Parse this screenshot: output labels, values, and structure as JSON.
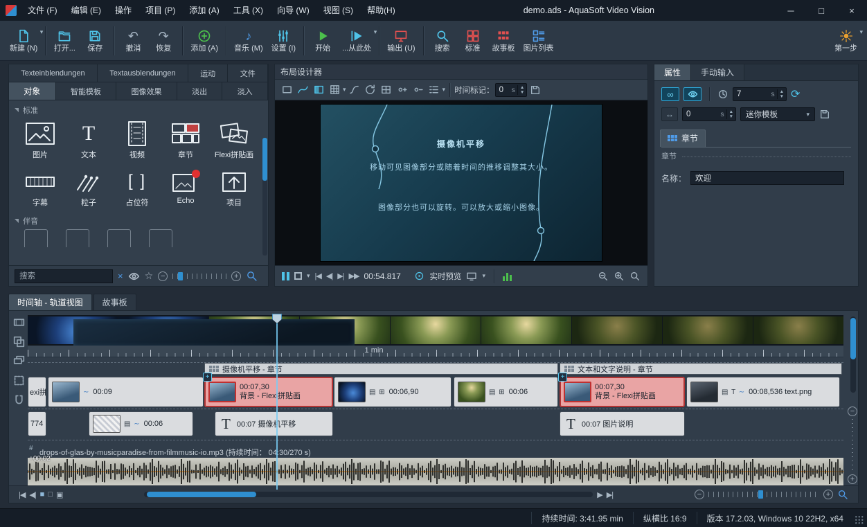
{
  "icons": {
    "chevron_down": "▾",
    "close": "×",
    "minimize": "─",
    "maximize": "□",
    "undo": "↶",
    "redo": "↷",
    "note": "♪",
    "infinity": "∞",
    "arrow_lr": "↔",
    "refresh": "⟳",
    "star": "☆",
    "minus": "−",
    "plus": "+",
    "skip_start": "|◀",
    "step_back": "◀|",
    "step_fwd": "▶|",
    "ffwd": "▶▶",
    "play_one": "▶",
    "play_end": "▶|",
    "stop_sq": "■",
    "frame_sq": "□",
    "split_sq": "▣",
    "film": "▤",
    "grid": "⊞",
    "wave": "∼",
    "t": "T",
    "brackets": "[ ]",
    "hash": "#"
  },
  "window": {
    "title": "demo.ads - AquaSoft Video Vision"
  },
  "menu": {
    "items": [
      "文件 (F)",
      "编辑 (E)",
      "操作",
      "项目 (P)",
      "添加 (A)",
      "工具 (X)",
      "向导 (W)",
      "视图 (S)",
      "帮助(H)"
    ]
  },
  "toolbar": {
    "buttons": [
      {
        "label": "新建 (N)"
      },
      {
        "label": "打开..."
      },
      {
        "label": "保存"
      },
      {
        "label": "撤消"
      },
      {
        "label": "恢复"
      },
      {
        "label": "添加 (A)"
      },
      {
        "label": "音乐 (M)"
      },
      {
        "label": "设置 (I)"
      },
      {
        "label": "开始"
      },
      {
        "label": "...从此处"
      },
      {
        "label": "输出 (U)"
      },
      {
        "label": "搜索"
      },
      {
        "label": "标准"
      },
      {
        "label": "故事板"
      },
      {
        "label": "图片列表"
      }
    ],
    "first_step": "第一步"
  },
  "left_panel": {
    "tabs_top": [
      "Texteinblendungen",
      "Textausblendungen",
      "运动",
      "文件"
    ],
    "tabs_main": [
      "对象",
      "智能模板",
      "图像效果",
      "淡出",
      "淡入"
    ],
    "section_standard": "标准",
    "section_audio": "伴音",
    "items": [
      {
        "label": "图片"
      },
      {
        "label": "文本"
      },
      {
        "label": "视频"
      },
      {
        "label": "章节"
      },
      {
        "label": "Flexi拼贴画"
      },
      {
        "label": "字幕"
      },
      {
        "label": "粒子"
      },
      {
        "label": "占位符"
      },
      {
        "label": "Echo"
      },
      {
        "label": "项目"
      }
    ],
    "search_placeholder": "搜索"
  },
  "designer": {
    "title": "布局设计器",
    "time_marker_label": "时间标记：",
    "time_marker_value": "0",
    "time_unit": "s",
    "slide": {
      "heading": "摄像机平移",
      "body1": "移动可见图像部分或随着时间的推移调整其大小。",
      "body2": "图像部分也可以旋转。可以放大或缩小图像。"
    },
    "transport": {
      "time": "00:54.817",
      "live_preview": "实时预览"
    }
  },
  "properties": {
    "tab_props": "属性",
    "tab_manual": "手动输入",
    "duration_value": "7",
    "duration_unit": "s",
    "offset_value": "0",
    "offset_unit": "s",
    "template_value": "迷你模板",
    "chapter_tab": "章节",
    "chapter_section": "章节",
    "name_label": "名称：",
    "name_value": "欢迎"
  },
  "timeline": {
    "tab_track": "时间轴 - 轨道视图",
    "tab_storyboard": "故事板",
    "ruler_label": "1 min",
    "filmstrip": [
      "slide",
      "slide",
      "slide",
      "slide",
      "slide",
      "slide",
      "slide",
      "slide",
      "slide",
      "slide",
      "flower",
      "flower",
      "forest",
      "forest",
      "forest",
      "forest",
      "dark",
      "dark",
      "dark"
    ],
    "group1": "摄像机平移 - 章节",
    "group2": "文本和文字说明 - 章节",
    "t1_partial": "exi拼",
    "clip1_time": "00:09",
    "clip2_time": "00:07,30",
    "clip2_name": "背景 - Flexi拼贴画",
    "clip3_time": "00:06,90",
    "clip4_time": "00:06",
    "clip5_time": "00:07,30",
    "clip5_name": "背景 - Flexi拼贴画",
    "clip6_time": "00:08,536 text.png",
    "t2_partial": "774",
    "t2c1_time": "00:06",
    "t2c2_time": "00:07 摄像机平移",
    "t2c3_time": "00:07 图片说明",
    "audio_label": "drops-of-glas-by-musicparadise-from-filmmusic-io.mp3 (持续时间： 04:30/270 s)",
    "audio_offset": "+00:02"
  },
  "status": {
    "duration": "持续时间: 3:41.95 min",
    "aspect": "纵横比 16:9",
    "version": "版本 17.2.03, Windows 10 22H2, x64"
  }
}
